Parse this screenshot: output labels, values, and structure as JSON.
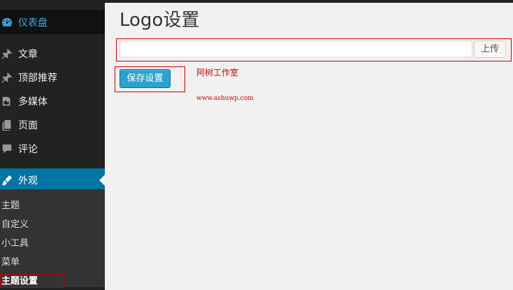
{
  "sidebar": {
    "items": [
      {
        "label": "仪表盘",
        "icon": "dashboard-icon"
      },
      {
        "label": "文章",
        "icon": "pin-icon"
      },
      {
        "label": "顶部推荐",
        "icon": "pin-icon"
      },
      {
        "label": "多媒体",
        "icon": "media-icon"
      },
      {
        "label": "页面",
        "icon": "page-icon"
      },
      {
        "label": "评论",
        "icon": "comment-icon"
      },
      {
        "label": "外观",
        "icon": "brush-icon"
      }
    ],
    "submenu": [
      {
        "label": "主题"
      },
      {
        "label": "自定义"
      },
      {
        "label": "小工具"
      },
      {
        "label": "菜单"
      },
      {
        "label": "主题设置"
      }
    ]
  },
  "main": {
    "title": "Logo设置",
    "logo_input": {
      "value": ""
    },
    "upload_label": "上传",
    "save_label": "保存设置",
    "studio_name": "阿树工作室",
    "studio_url": "www.ashuwp.com"
  },
  "colors": {
    "sidebar_bg": "#222222",
    "active_bg": "#0074a2",
    "accent": "#45a4d8",
    "button_primary": "#2ea2cc",
    "annotation_red": "#cc0000"
  }
}
